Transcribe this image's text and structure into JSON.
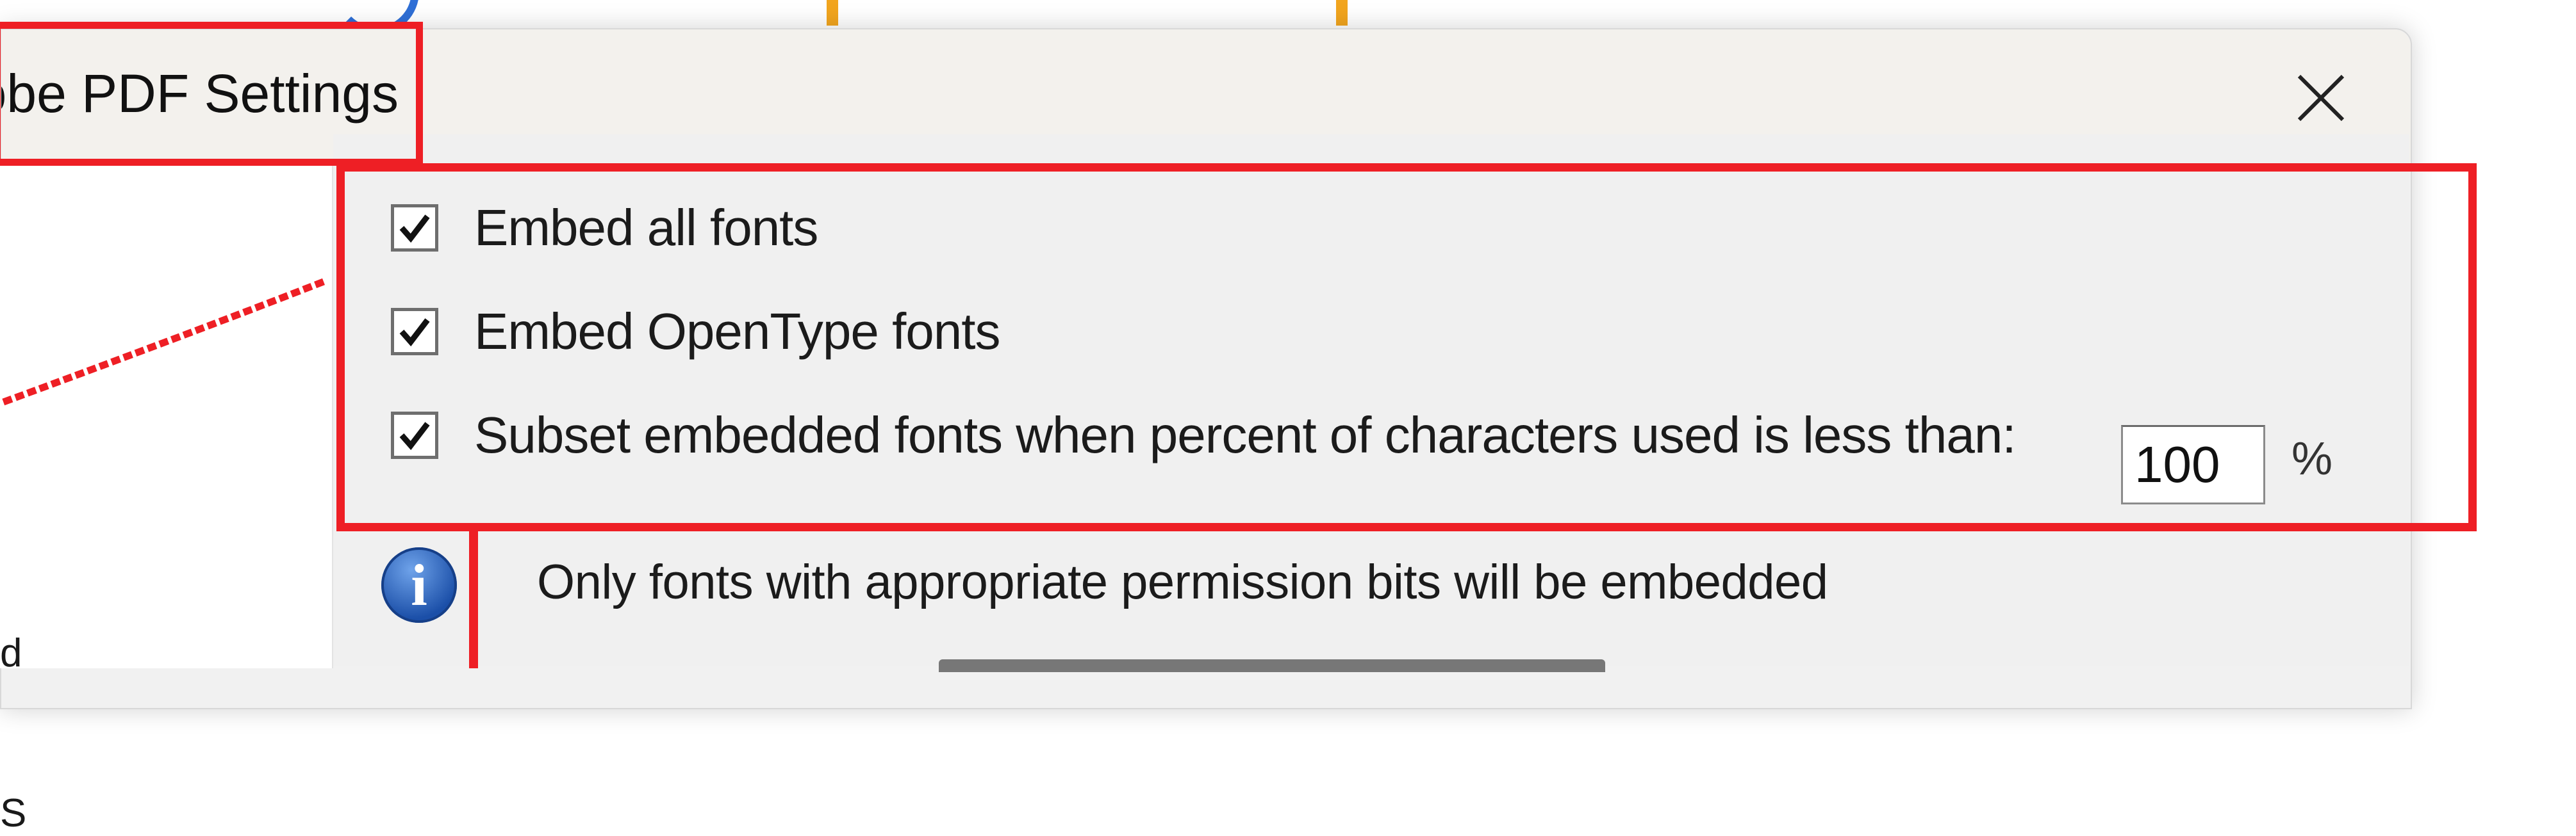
{
  "dialog": {
    "title": "obe PDF Settings",
    "close_label": "×"
  },
  "fonts": {
    "embed_all": {
      "label": "Embed all fonts",
      "checked": true
    },
    "embed_opentype": {
      "label": "Embed OpenType fonts",
      "checked": true
    },
    "subset": {
      "label": "Subset embedded fonts when percent of characters used is less than:",
      "checked": true
    },
    "subset_percent": "100",
    "percent_sign": "%"
  },
  "info": {
    "icon": "info-icon",
    "glyph": "i",
    "message": "Only fonts with appropriate permission bits will be embedded"
  },
  "left_panel": {
    "partial_labels": [
      "d",
      "S"
    ]
  },
  "colors": {
    "highlight": "#ee1f25",
    "info_blue": "#1b4fa8",
    "accent_orange": "#f2a51e"
  }
}
